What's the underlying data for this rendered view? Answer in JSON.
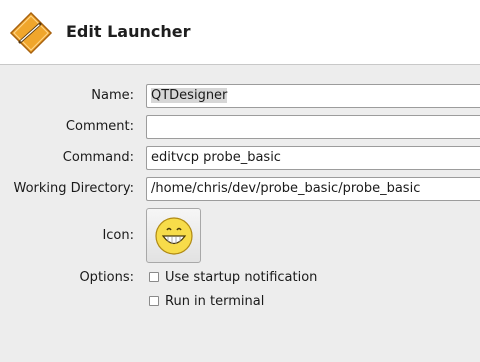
{
  "window": {
    "title": "Edit Launcher"
  },
  "fields": {
    "name": {
      "label": "Name:",
      "value": "QTDesigner"
    },
    "comment": {
      "label": "Comment:",
      "value": ""
    },
    "command": {
      "label": "Command:",
      "value": "editvcp probe_basic"
    },
    "working_directory": {
      "label": "Working Directory:",
      "value": "/home/chris/dev/probe_basic/probe_basic"
    },
    "icon": {
      "label": "Icon:",
      "icon_name": "grin-emoji-icon"
    }
  },
  "options": {
    "label": "Options:",
    "items": [
      {
        "label": "Use startup notification",
        "checked": false
      },
      {
        "label": "Run in terminal",
        "checked": false
      }
    ]
  },
  "colors": {
    "header_icon": "#e8961e",
    "emoji_yellow": "#f7dc4a"
  }
}
